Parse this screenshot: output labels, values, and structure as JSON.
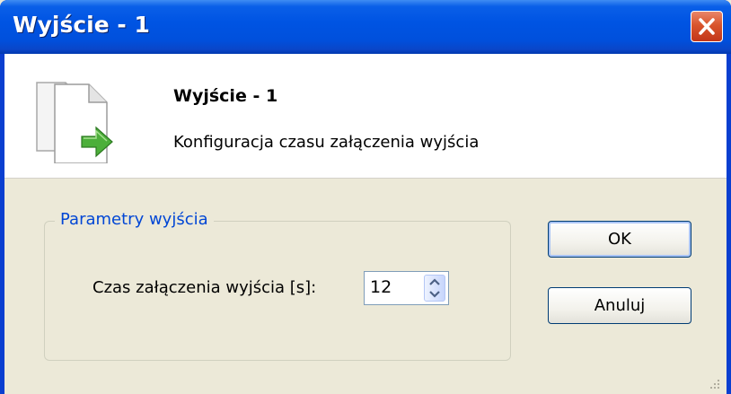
{
  "window": {
    "title": "Wyjście - 1",
    "close_icon": "close-x-icon"
  },
  "header": {
    "icon": "documents-arrow-icon",
    "title": "Wyjście - 1",
    "subtitle": "Konfiguracja czasu załączenia wyjścia"
  },
  "group": {
    "legend": "Parametry wyjścia",
    "field_label": "Czas załączenia wyjścia [s]:",
    "spinner_value": "12"
  },
  "buttons": {
    "ok": "OK",
    "cancel": "Anuluj"
  },
  "colors": {
    "titlebar": "#0054e3",
    "close": "#d9552c",
    "legend_text": "#0046d5",
    "dialog_bg": "#ece9d8"
  }
}
